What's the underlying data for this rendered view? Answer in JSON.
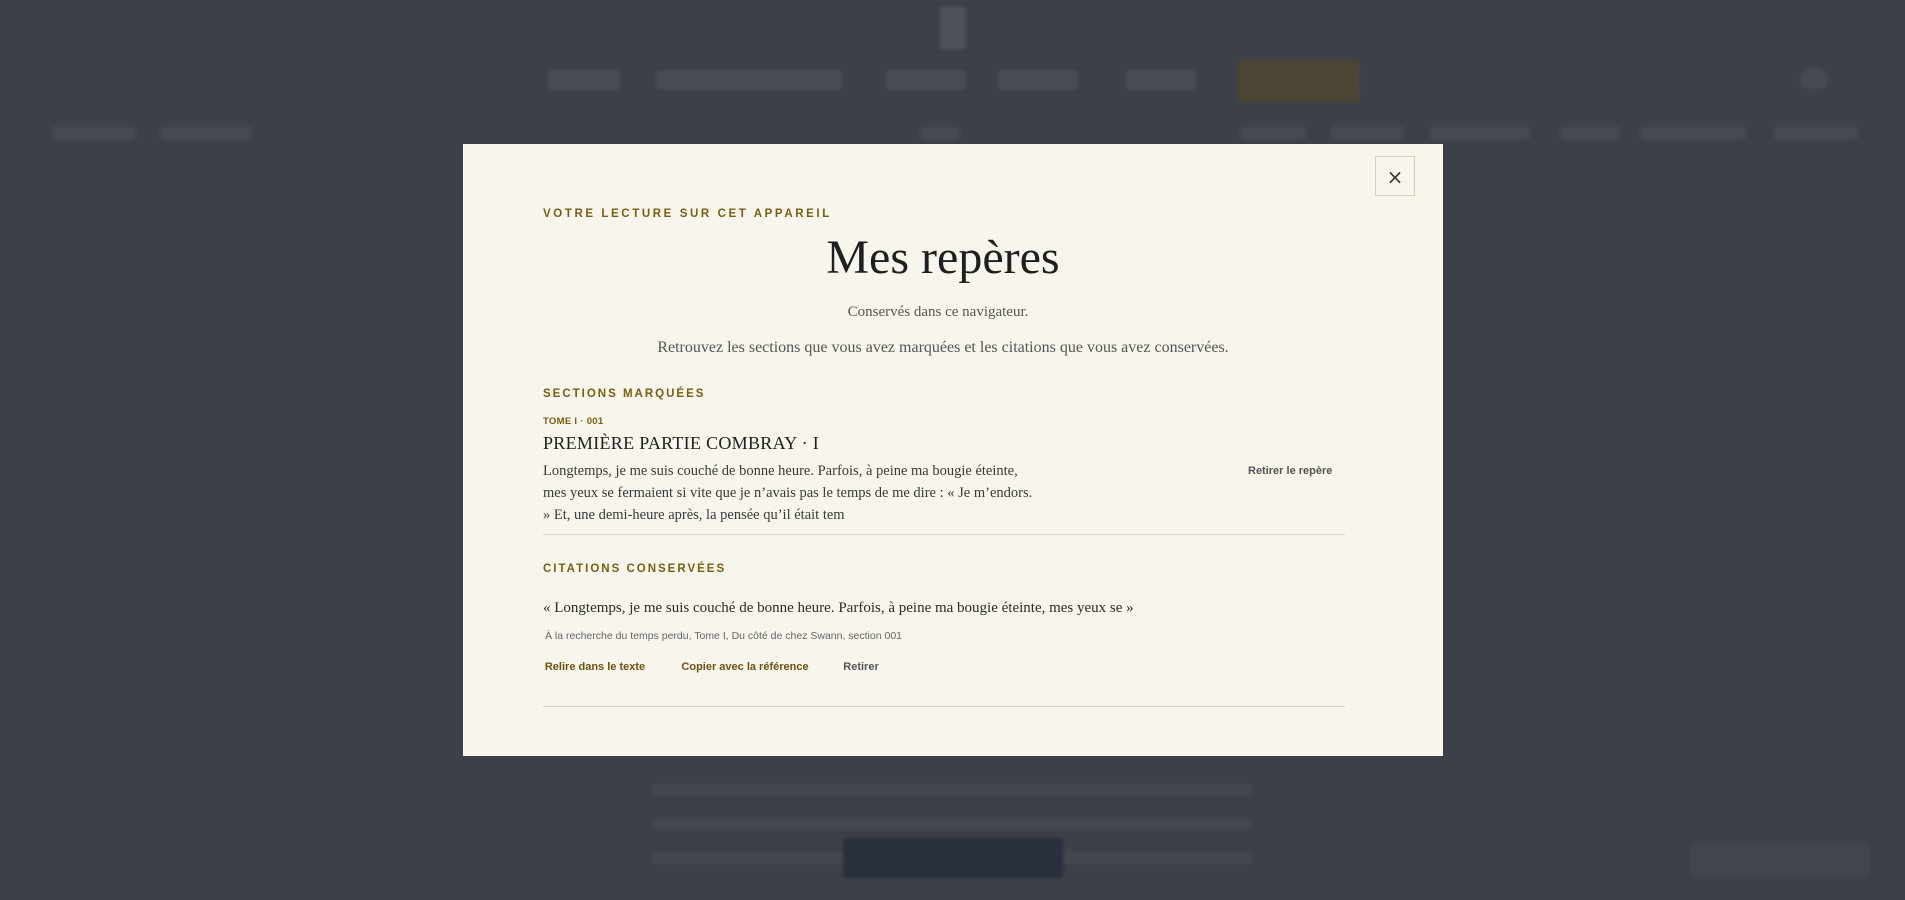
{
  "modal": {
    "close_label": "×",
    "eyebrow": "VOTRE LECTURE SUR CET APPAREIL",
    "title": "Mes repères",
    "subtitle": "Conservés dans ce navigateur.",
    "intro": "Retrouvez les sections que vous avez marquées et les citations que vous avez conservées."
  },
  "bookmarks": {
    "label": "SECTIONS MARQUÉES",
    "items": [
      {
        "kicker": "TOME I · 001",
        "title": "PREMIÈRE PARTIE COMBRAY · I",
        "excerpt": "Longtemps, je me suis couché de bonne heure. Parfois, à peine ma bougie éteinte, mes yeux se fermaient si vite que je n’avais pas le temps de me dire : « Je m’endors. » Et, une demi-heure après, la pensée qu’il était tem",
        "remove_label": "Retirer le repère"
      }
    ]
  },
  "quotes": {
    "label": "CITATIONS CONSERVÉES",
    "items": [
      {
        "text": "« Longtemps, je me suis couché de bonne heure. Parfois, à peine ma bougie éteinte, mes yeux se »",
        "reference": "À la recherche du temps perdu, Tome I, Du côté de chez Swann, section 001",
        "reread_label": "Relire dans le texte",
        "copy_label": "Copier avec la référence",
        "remove_label": "Retirer"
      }
    ]
  }
}
